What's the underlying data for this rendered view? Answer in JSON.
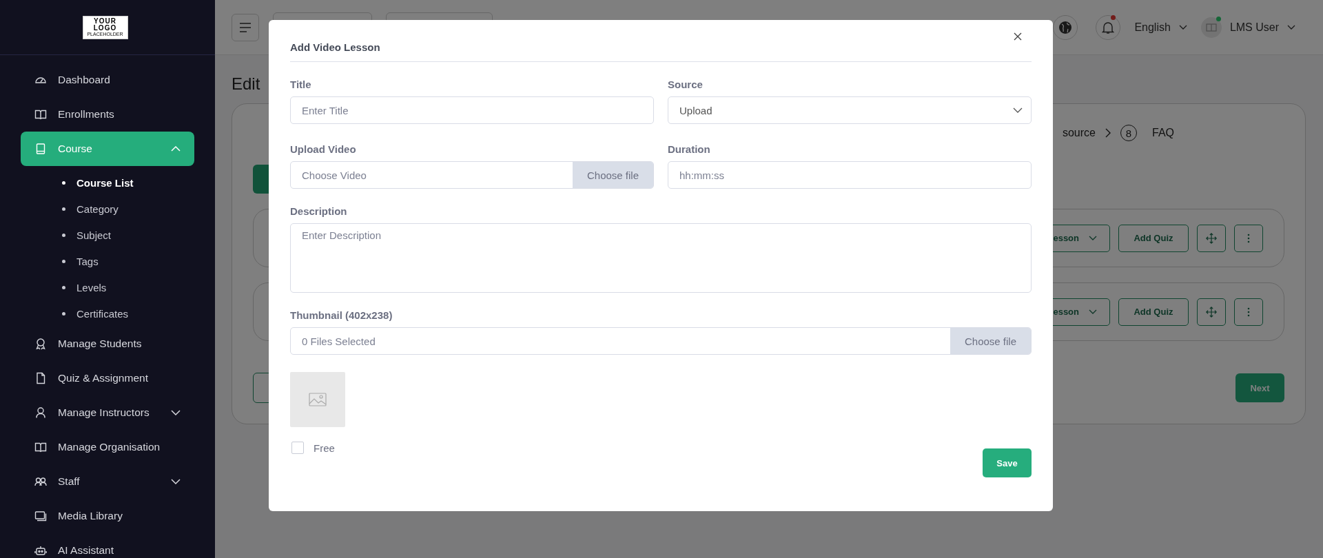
{
  "sidebar": {
    "logo": {
      "line_1": "YOUR",
      "line_2": "LOGO",
      "line_3": "PLACEHOLDER"
    },
    "items": [
      {
        "label": "Dashboard",
        "selected": false
      },
      {
        "label": "Enrollments",
        "selected": false
      },
      {
        "label": "Course",
        "selected": true,
        "expanded": true,
        "children": [
          {
            "label": "Course List",
            "selected": true
          },
          {
            "label": "Category",
            "selected": false
          },
          {
            "label": "Subject",
            "selected": false
          },
          {
            "label": "Tags",
            "selected": false
          },
          {
            "label": "Levels",
            "selected": false
          },
          {
            "label": "Certificates",
            "selected": false
          }
        ]
      },
      {
        "label": "Manage Students",
        "selected": false
      },
      {
        "label": "Quiz & Assignment",
        "selected": false
      },
      {
        "label": "Manage Instructors",
        "selected": false,
        "expanded": false
      },
      {
        "label": "Manage Organisation",
        "selected": false
      },
      {
        "label": "Staff",
        "selected": false,
        "expanded": false
      },
      {
        "label": "Media Library",
        "selected": false
      },
      {
        "label": "AI Assistant",
        "selected": false
      }
    ]
  },
  "header": {
    "notifications_unread": true,
    "language": "English",
    "user": {
      "name": "LMS User",
      "online": true
    }
  },
  "page": {
    "title": "Edit",
    "steps": [
      {
        "label": "source"
      },
      {
        "number": "8",
        "label": "FAQ"
      }
    ],
    "sections": [
      {
        "lesson_button": "esson",
        "quiz_button": "Add Quiz"
      },
      {
        "lesson_button": "esson",
        "quiz_button": "Add Quiz"
      }
    ],
    "next_button": "Next"
  },
  "modal": {
    "title": "Add Video Lesson",
    "title_field": {
      "label": "Title",
      "placeholder": "Enter Title"
    },
    "source_field": {
      "label": "Source",
      "value": "Upload"
    },
    "upload_video": {
      "label": "Upload Video",
      "placeholder": "Choose Video",
      "button": "Choose file"
    },
    "duration": {
      "label": "Duration",
      "placeholder": "hh:mm:ss"
    },
    "description": {
      "label": "Description",
      "placeholder": "Enter Description"
    },
    "thumbnail": {
      "label": "Thumbnail (402x238)",
      "status": "0 Files Selected",
      "button": "Choose file"
    },
    "free": {
      "label": "Free",
      "checked": false
    },
    "save_button": "Save"
  }
}
